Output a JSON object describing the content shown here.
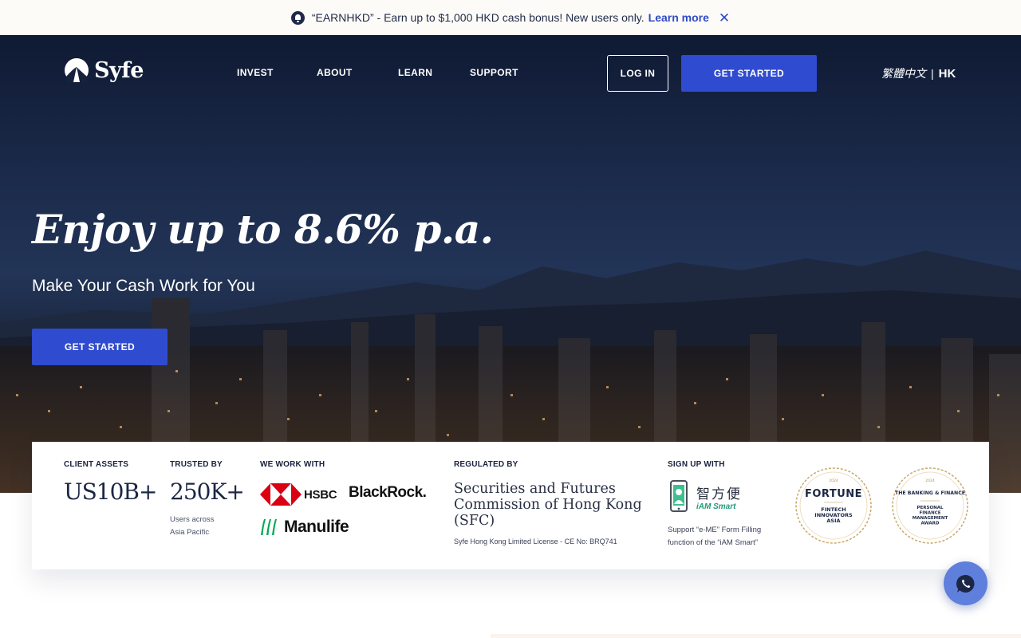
{
  "promo": {
    "text": "“EARNHKD” - Earn up to $1,000 HKD cash bonus! New users only.",
    "link": "Learn more",
    "close_symbol": "✕",
    "icons": [
      "bell-icon",
      "close-icon"
    ]
  },
  "header": {
    "logo_text": "Syfe",
    "nav": [
      "INVEST",
      "ABOUT",
      "LEARN",
      "SUPPORT"
    ],
    "login_label": "LOG IN",
    "get_started_label": "GET STARTED",
    "language": "繁體中文",
    "separator": "|",
    "region": "HK"
  },
  "hero": {
    "headline": "Enjoy up to 8.6% p.a.",
    "subheadline": "Make Your Cash Work for You",
    "cta_label": "GET STARTED"
  },
  "trust": {
    "client_assets_label": "CLIENT ASSETS",
    "client_assets_value": "US10B+",
    "trusted_by_label": "TRUSTED BY",
    "trusted_by_value": "250K+",
    "trusted_by_note_line1": "Users across",
    "trusted_by_note_line2": "Asia Pacific",
    "partners_label": "WE WORK WITH",
    "partners": [
      "HSBC",
      "BlackRock.",
      "Manulife"
    ],
    "regulated_label": "REGULATED BY",
    "regulator_line1": "Securities and Futures",
    "regulator_line2": "Commission of Hong Kong",
    "regulator_line3": "(SFC)",
    "license": "Syfe Hong Kong Limited License - CE No: BRQ741",
    "signup_label": "SIGN UP WITH",
    "iam_zh": "智方便",
    "iam_en": "iAM Smart",
    "iam_note_line1": "Support “e-ME” Form Filling",
    "iam_note_line2": "function of the “iAM Smart”",
    "awards": [
      {
        "title": "FORTUNE",
        "year": "2024",
        "line1": "FINTECH",
        "line2": "INNOVATORS",
        "line3": "ASIA"
      },
      {
        "title": "THE BANKING & FINANCE",
        "year": "2024",
        "line1": "PERSONAL",
        "line2": "FINANCE",
        "line3": "MANAGEMENT",
        "line4": "AWARD"
      }
    ]
  },
  "colors": {
    "brand_blue": "#2f4bd0",
    "navy": "#1c2746",
    "chat_blue": "#5f7fdc",
    "award_gold": "#b89253"
  }
}
